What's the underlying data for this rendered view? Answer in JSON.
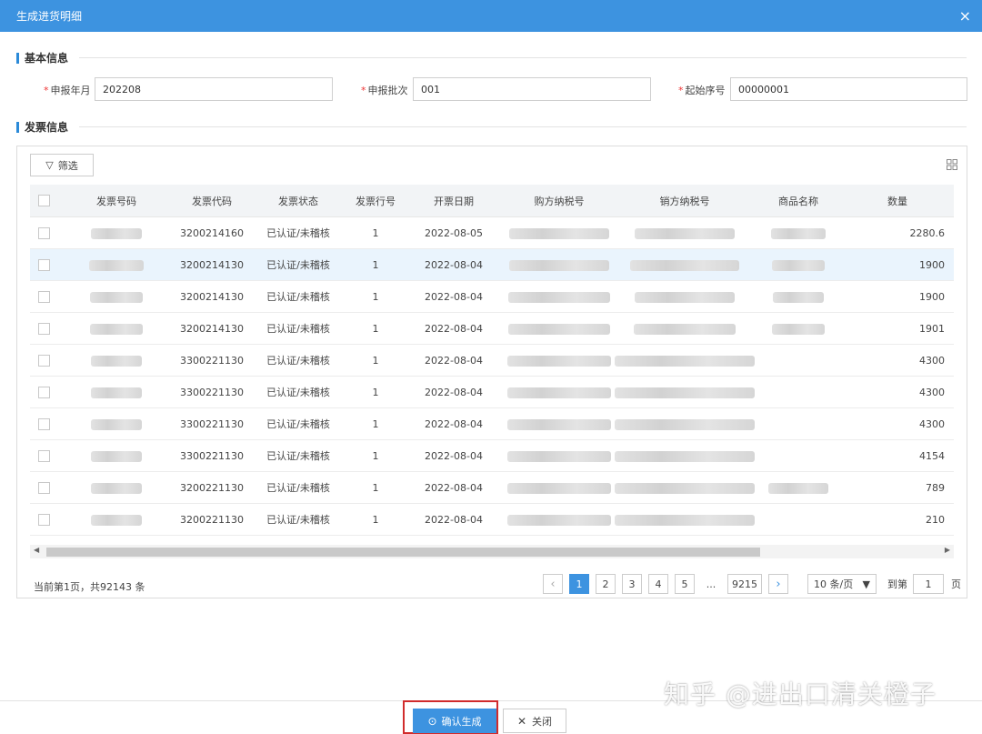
{
  "dialog": {
    "title": "生成进货明细",
    "close_symbol": "×"
  },
  "basic": {
    "section_title": "基本信息",
    "fields": [
      {
        "label": "申报年月",
        "value": "202208"
      },
      {
        "label": "申报批次",
        "value": "001"
      },
      {
        "label": "起始序号",
        "value": "00000001"
      }
    ]
  },
  "invoice": {
    "section_title": "发票信息",
    "filter_label": "筛选",
    "columns": [
      "发票号码",
      "发票代码",
      "发票状态",
      "发票行号",
      "开票日期",
      "购方纳税号",
      "销方纳税号",
      "商品名称",
      "数量"
    ],
    "rows": [
      {
        "code": "3200214160",
        "status": "已认证/未稽核",
        "line": "1",
        "date": "2022-08-05",
        "qty": "2280.6"
      },
      {
        "code": "3200214130",
        "status": "已认证/未稽核",
        "line": "1",
        "date": "2022-08-04",
        "qty": "1900",
        "selected": true
      },
      {
        "code": "3200214130",
        "status": "已认证/未稽核",
        "line": "1",
        "date": "2022-08-04",
        "qty": "1900"
      },
      {
        "code": "3200214130",
        "status": "已认证/未稽核",
        "line": "1",
        "date": "2022-08-04",
        "qty": "1901"
      },
      {
        "code": "3300221130",
        "status": "已认证/未稽核",
        "line": "1",
        "date": "2022-08-04",
        "qty": "4300"
      },
      {
        "code": "3300221130",
        "status": "已认证/未稽核",
        "line": "1",
        "date": "2022-08-04",
        "qty": "4300"
      },
      {
        "code": "3300221130",
        "status": "已认证/未稽核",
        "line": "1",
        "date": "2022-08-04",
        "qty": "4300"
      },
      {
        "code": "3300221130",
        "status": "已认证/未稽核",
        "line": "1",
        "date": "2022-08-04",
        "qty": "4154"
      },
      {
        "code": "3200221130",
        "status": "已认证/未稽核",
        "line": "1",
        "date": "2022-08-04",
        "qty": "789"
      },
      {
        "code": "3200221130",
        "status": "已认证/未稽核",
        "line": "1",
        "date": "2022-08-04",
        "qty": "210"
      }
    ]
  },
  "pagination": {
    "info": "当前第1页，共92143 条",
    "pages": [
      "1",
      "2",
      "3",
      "4",
      "5"
    ],
    "ellipsis": "...",
    "last_page": "9215",
    "page_size": "10 条/页",
    "goto_label": "到第",
    "goto_value": "1",
    "goto_suffix": "页"
  },
  "footer": {
    "confirm_label": "确认生成",
    "close_label": "关闭"
  },
  "watermark": "知乎 @进出口清关橙子",
  "colors": {
    "accent": "#3d93e0",
    "highlight_border": "#d12c2c",
    "selected_row": "#eaf4fd"
  }
}
